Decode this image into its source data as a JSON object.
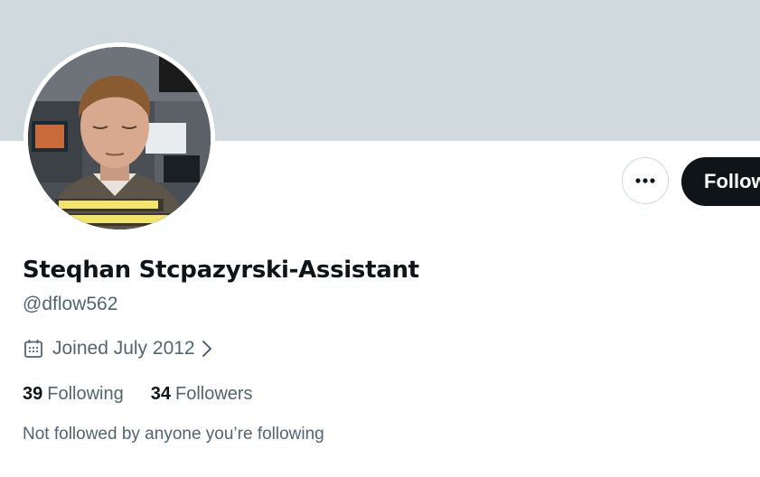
{
  "profile": {
    "display_name": "Steqhan Stcpazyrski-Assistant",
    "handle": "@dflow562",
    "joined": "Joined July 2012",
    "following_count": "39",
    "following_label": "Following",
    "followers_count": "34",
    "followers_label": "Followers",
    "not_followed_text": "Not followed by anyone you’re following"
  },
  "actions": {
    "follow_label": "Follow"
  },
  "icons": {
    "calendar": "calendar-icon",
    "chevron": "chevron-right-icon",
    "more": "more-icon"
  },
  "colors": {
    "banner": "#cfd9de",
    "follow_button": "#0f1419",
    "secondary_text": "#536471",
    "primary_text": "#0f1419"
  }
}
